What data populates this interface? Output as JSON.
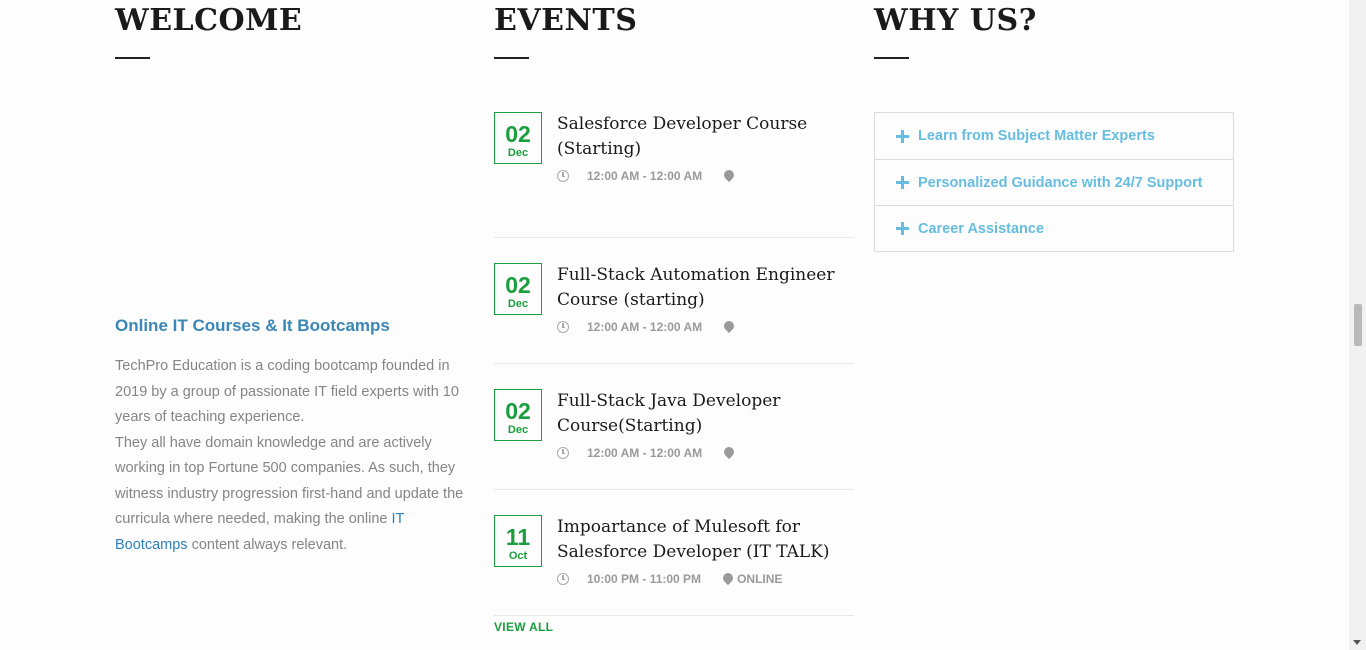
{
  "welcome": {
    "heading": "WELCOME",
    "subheading": "Online IT Courses & It Bootcamps",
    "body_part1": "TechPro Education is a coding bootcamp founded in 2019 by a group of passionate IT field experts with 10 years of teaching experience.",
    "body_part2": "They all have domain knowledge and are actively working in top Fortune 500 companies. As such, they witness industry progression first-hand and update the curricula where needed, making the online",
    "body_link": "IT Bootcamps",
    "body_part3": "content always relevant."
  },
  "events": {
    "heading": "EVENTS",
    "items": [
      {
        "day": "02",
        "month": "Dec",
        "title": "Salesforce Developer Course (Starting)",
        "time": "12:00 AM - 12:00 AM",
        "location": ""
      },
      {
        "day": "02",
        "month": "Dec",
        "title": "Full-Stack Automation Engineer Course (starting)",
        "time": "12:00 AM - 12:00 AM",
        "location": ""
      },
      {
        "day": "02",
        "month": "Dec",
        "title": "Full-Stack Java Developer Course(Starting)",
        "time": "12:00 AM - 12:00 AM",
        "location": ""
      },
      {
        "day": "11",
        "month": "Oct",
        "title": "Impoartance of Mulesoft for Salesforce Developer (IT TALK)",
        "time": "10:00 PM - 11:00 PM",
        "location": "ONLINE"
      }
    ],
    "view_all": "VIEW ALL"
  },
  "why_us": {
    "heading": "WHY US?",
    "items": [
      {
        "label": "Learn from Subject Matter Experts"
      },
      {
        "label": "Personalized Guidance with 24/7 Support"
      },
      {
        "label": "Career Assistance"
      }
    ]
  },
  "colors": {
    "accent_green": "#1b9e3e",
    "accent_blue": "#66bde0",
    "link_blue": "#3a87b7"
  },
  "icons": {
    "time": "clock-icon",
    "location": "map-pin-icon",
    "expand": "plus-icon"
  }
}
